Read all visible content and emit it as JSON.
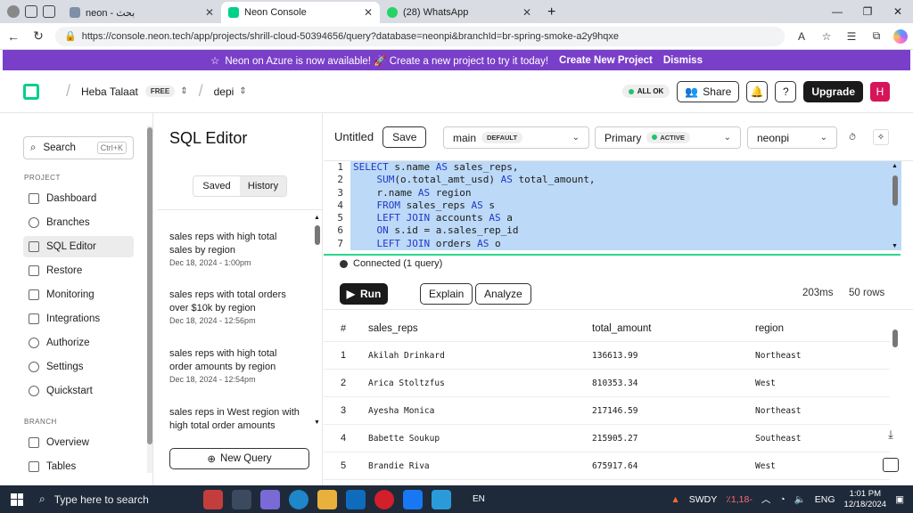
{
  "browser": {
    "tabs": [
      {
        "title": "neon - بحث",
        "color": "#7f8fa6"
      },
      {
        "title": "Neon Console",
        "color": "#00d08a"
      },
      {
        "title": "(28) WhatsApp",
        "color": "#25d366"
      }
    ],
    "url": "https://console.neon.tech/app/projects/shrill-cloud-50394656/query?database=neonpi&branchId=br-spring-smoke-a2y9hqxe"
  },
  "banner": {
    "text": "Neon on Azure is now available! 🚀 Create a new project to try it today!",
    "cta": "Create New Project",
    "dismiss": "Dismiss"
  },
  "header": {
    "user": "Heba Talaat",
    "plan": "FREE",
    "project": "depi",
    "status": "ALL OK",
    "share": "Share",
    "upgrade": "Upgrade",
    "avatar": "H"
  },
  "sidebar": {
    "search": "Search",
    "shortcut": "Ctrl+K",
    "project_label": "PROJECT",
    "project_items": [
      "Dashboard",
      "Branches",
      "SQL Editor",
      "Restore",
      "Monitoring",
      "Integrations",
      "Authorize",
      "Settings",
      "Quickstart"
    ],
    "branch_label": "BRANCH",
    "branch_items": [
      "Overview",
      "Tables"
    ]
  },
  "queries": {
    "title": "SQL Editor",
    "tab_saved": "Saved",
    "tab_history": "History",
    "items": [
      {
        "title": "sales reps with high total sales by region",
        "date": "Dec 18, 2024 - 1:00pm"
      },
      {
        "title": "sales reps with total orders over $10k by region",
        "date": "Dec 18, 2024 - 12:56pm"
      },
      {
        "title": "sales reps with high total order amounts by region",
        "date": "Dec 18, 2024 - 12:54pm"
      },
      {
        "title": "sales reps in West region with high total order amounts",
        "date": ""
      }
    ],
    "new_query": "New Query"
  },
  "editor": {
    "title": "Untitled",
    "save": "Save",
    "branch": "main",
    "branch_badge": "DEFAULT",
    "compute": "Primary",
    "compute_badge": "ACTIVE",
    "database": "neonpi",
    "lines": [
      "SELECT s.name AS sales_reps,",
      "    SUM(o.total_amt_usd) AS total_amount,",
      "    r.name AS region",
      "    FROM sales_reps AS s",
      "    LEFT JOIN accounts AS a",
      "    ON s.id = a.sales_rep_id",
      "    LEFT JOIN orders AS o"
    ],
    "status": "Connected (1 query)",
    "run": "Run",
    "explain": "Explain",
    "analyze": "Analyze",
    "time": "203ms",
    "rows": "50 rows"
  },
  "results": {
    "columns": [
      "#",
      "sales_reps",
      "total_amount",
      "region"
    ],
    "rows": [
      [
        "1",
        "Akilah Drinkard",
        "136613.99",
        "Northeast"
      ],
      [
        "2",
        "Arica Stoltzfus",
        "810353.34",
        "West"
      ],
      [
        "3",
        "Ayesha Monica",
        "217146.59",
        "Northeast"
      ],
      [
        "4",
        "Babette Soukup",
        "215905.27",
        "Southeast"
      ],
      [
        "5",
        "Brandie Riva",
        "675917.64",
        "West"
      ]
    ]
  },
  "taskbar": {
    "search": "Type here to search",
    "lang": "EN",
    "stock": "SWDY",
    "stock_change": "٪1,18-",
    "input": "ENG",
    "time": "1:01 PM",
    "date": "12/18/2024"
  }
}
